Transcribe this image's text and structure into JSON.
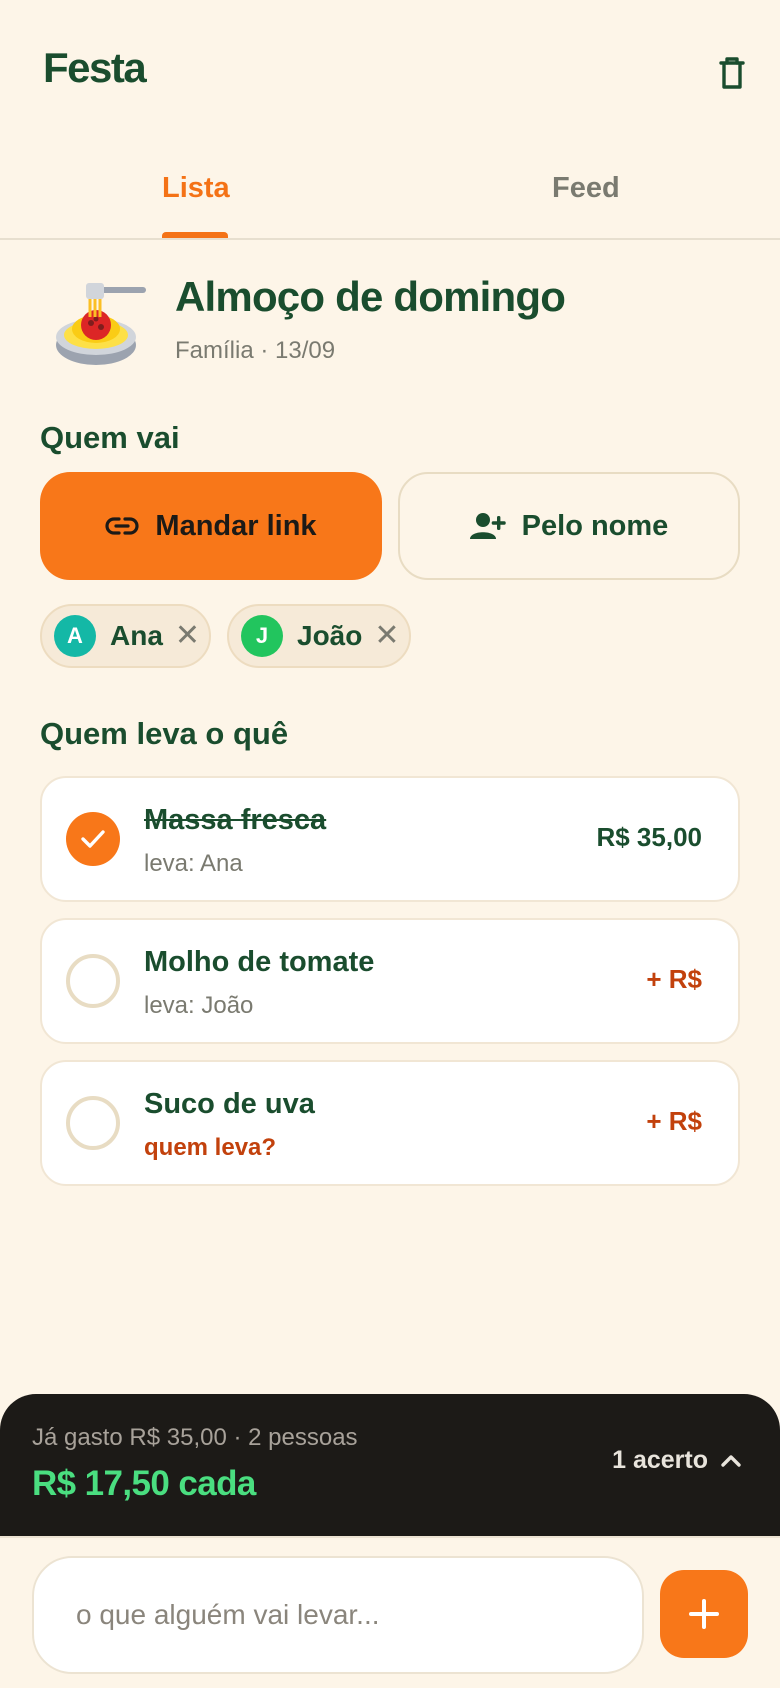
{
  "app": {
    "title": "Festa",
    "trash_icon": "trash-icon"
  },
  "tabs": [
    {
      "label": "Lista",
      "active": true
    },
    {
      "label": "Feed",
      "active": false
    }
  ],
  "event": {
    "emoji": "spaghetti-icon",
    "title": "Almoço de domingo",
    "meta": "Família · 13/09"
  },
  "guests_section": {
    "title": "Quem vai",
    "send_link_label": "Mandar link",
    "by_name_label": "Pelo nome",
    "guests": [
      {
        "initial": "A",
        "name": "Ana",
        "color": "#14b8a6"
      },
      {
        "initial": "J",
        "name": "João",
        "color": "#22c55e"
      }
    ]
  },
  "items_section": {
    "title": "Quem leva o quê",
    "items": [
      {
        "name": "Massa fresca",
        "sub": "leva: Ana",
        "price": "R$ 35,00",
        "done": true
      },
      {
        "name": "Molho de tomate",
        "sub": "leva: João",
        "price": "+ R$",
        "done": false
      },
      {
        "name": "Suco de uva",
        "sub": "quem leva?",
        "price": "+ R$",
        "done": false
      }
    ]
  },
  "summary": {
    "spent": "Já gasto R$ 35,00 · 2 pessoas",
    "per_person": "R$ 17,50 cada",
    "settle": "1 acerto"
  },
  "composer": {
    "placeholder": "o que alguém vai levar..."
  },
  "colors": {
    "accent": "#f87719",
    "primary": "#1a4d2e",
    "positive": "#4ade80",
    "warning": "#c2410c"
  }
}
